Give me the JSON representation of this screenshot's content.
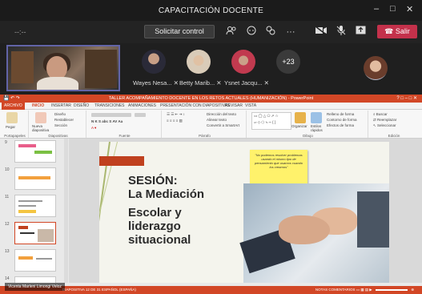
{
  "window": {
    "title": "CAPACITACIÓN DOCENTE",
    "controls": [
      "–",
      "□",
      "✕"
    ]
  },
  "toolbar": {
    "timer": "--:--",
    "request_control_label": "Solicitar control",
    "leave_label": "Salir",
    "accent_color": "#c4314b",
    "icons": [
      "people-icon",
      "chat-icon",
      "reactions-icon",
      "more-icon",
      "camera-icon",
      "mic-icon",
      "share-icon",
      "phone-icon"
    ]
  },
  "participants": [
    {
      "name": "Wayes Nesa..."
    },
    {
      "name": "Betty Marib..."
    },
    {
      "name": "Ysnet Jacqu..."
    }
  ],
  "participants_more": "+23",
  "powerpoint": {
    "title": "TALLER ACOMPAÑAMIENTO DOCENTE EN LOS RETOS ACTUALES (HUMANIZACIÓN) - PowerPoint",
    "tabs": [
      "ARCHIVO",
      "INICIO",
      "INSERTAR",
      "DISEÑO",
      "TRANSICIONES",
      "ANIMACIONES",
      "PRESENTACIÓN CON DIAPOSITIVAS",
      "REVISAR",
      "VISTA"
    ],
    "ribbon_groups": [
      "Portapapeles",
      "Diapositivas",
      "Fuente",
      "Párrafo",
      "Dibujo",
      "Edición"
    ],
    "ribbon_items": {
      "paste": "Pegar",
      "new_slide": "Nueva diapositiva",
      "layout": "Diseño",
      "reset": "Restablecer",
      "section": "Sección",
      "text_direction": "Dirección del texto",
      "align_text": "Alinear texto",
      "convert_smartart": "Convertir a SmartArt",
      "arrange": "Organizar",
      "quick_styles": "Estilos rápidos",
      "shape_fill": "Relleno de forma",
      "shape_outline": "Contorno de forma",
      "shape_effects": "Efectos de forma",
      "find": "Buscar",
      "replace": "Reemplazar",
      "select": "Seleccionar"
    },
    "thumbnail_numbers": [
      "9",
      "10",
      "11",
      "12",
      "13",
      "14"
    ],
    "slide": {
      "title_line1": "SESIÓN:",
      "title_line2": "La Mediación",
      "title_line3": "Escolar y",
      "title_line4": "liderazgo",
      "title_line5": "situacional",
      "quote": "\"No podemos resolver problemas usando el mismo tipo de pensamiento que usamos cuando los creamos\"",
      "quote_author": "Albert Einstein"
    },
    "presenter_label": "Vicenta Marleni Limongi Veloz",
    "status_left": "DIAPOSITIVA 12 DE 31   ESPAÑOL (ESPAÑA)",
    "status_right": "NOTAS   COMENTARIOS"
  }
}
